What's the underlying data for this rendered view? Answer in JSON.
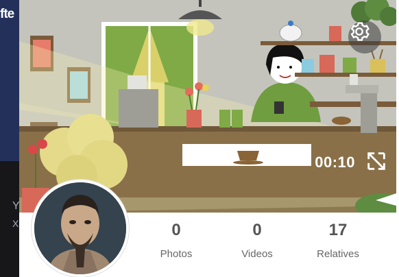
{
  "background_fragments": {
    "top_text": "fte",
    "mid_text": "Y",
    "mid_text2": "X"
  },
  "cover": {
    "video_time": "00:10",
    "settings_icon": "gear-icon",
    "expand_icon": "expand-icon"
  },
  "profile": {
    "avatar_icon": "avatar"
  },
  "stats": [
    {
      "value": "0",
      "label": "Photos"
    },
    {
      "value": "0",
      "label": "Videos"
    },
    {
      "value": "17",
      "label": "Relatives"
    }
  ],
  "colors": {
    "cover_wall": "#c4c4bc",
    "counter": "#8a7048",
    "window_green": "#7faa46"
  }
}
